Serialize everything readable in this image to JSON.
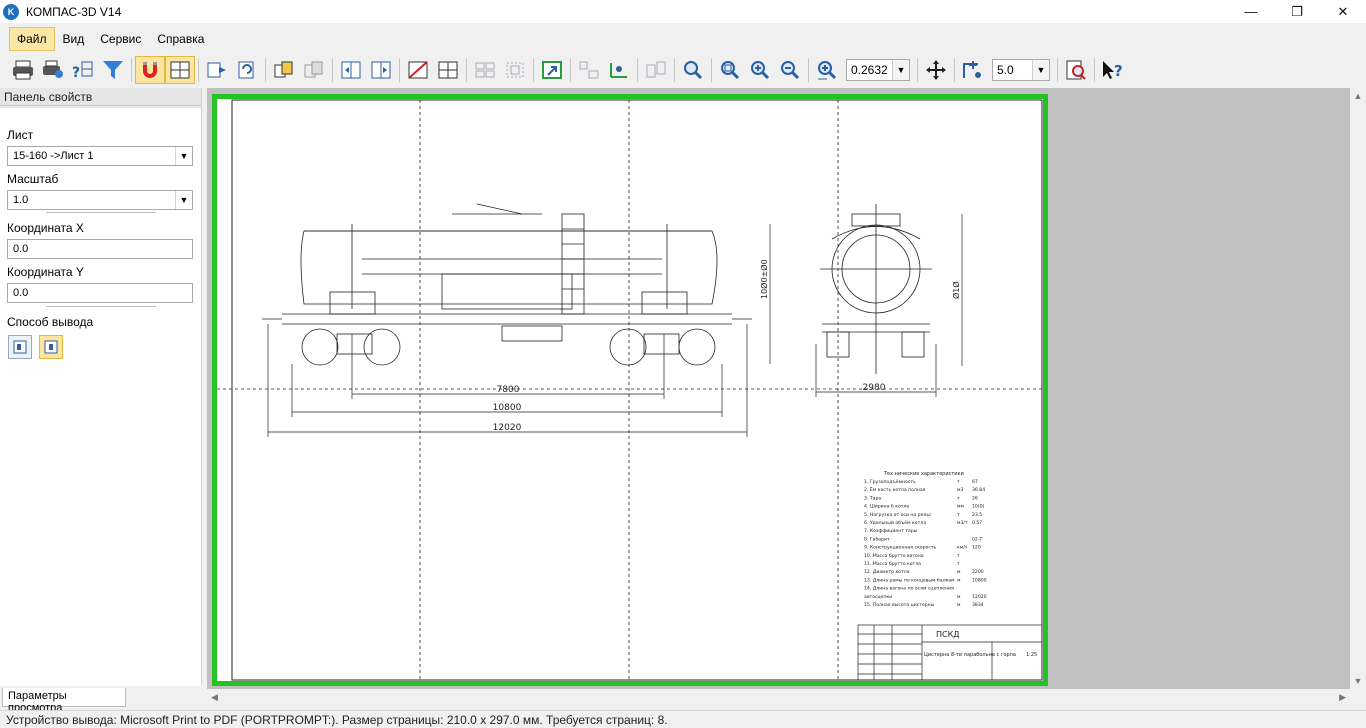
{
  "window": {
    "title": "КОМПАС-3D V14",
    "logo_letter": "K"
  },
  "window_buttons": {
    "minimize": "—",
    "maximize": "❐",
    "close": "✕"
  },
  "menu": [
    {
      "label": "Файл"
    },
    {
      "label": "Вид"
    },
    {
      "label": "Сервис"
    },
    {
      "label": "Справка"
    }
  ],
  "toolbar": {
    "zoom_value": "0.2632",
    "step_value": "5.0"
  },
  "panel": {
    "title": "Панель свойств",
    "sheet_label": "Лист",
    "sheet_value": "15-160 ->Лист 1",
    "scale_label": "Масштаб",
    "scale_value": "1.0",
    "coord_x_label": "Координата X",
    "coord_x_value": "0.0",
    "coord_y_label": "Координата Y",
    "coord_y_value": "0.0",
    "output_label": "Способ вывода",
    "tab_label": "Параметры просмотра"
  },
  "drawing": {
    "dim_7800": "7800",
    "dim_10800": "10800",
    "dim_12020": "12020",
    "dim_2980": "2980",
    "dim_height": "10Ø0±Ø0",
    "dim_height_right": "Ø1Ø",
    "title_block_code": "ПСКД",
    "title_block_name": "Цистерна 8-ти парабольна с горла",
    "title_block_scale": "1:25",
    "spec_title": "Тех нические характеристики",
    "spec_rows": [
      {
        "text": "1.  Грузоподъёмность",
        "unit": "т",
        "val": "67"
      },
      {
        "text": "2.  Ём кость котла полная",
        "unit": "м3",
        "val": "36.84"
      },
      {
        "text": "3.  Тара",
        "unit": "т",
        "val": "26"
      },
      {
        "text": "4.  Ширина б котла",
        "unit": "мм",
        "val": "10(0)"
      },
      {
        "text": "5.  Нагрузка от оси на рельс",
        "unit": "т",
        "val": "23.5"
      },
      {
        "text": "6.  Удельный объём котла",
        "unit": "м3/т",
        "val": "0.57"
      },
      {
        "text": "7.  Коэффициент тары",
        "unit": "",
        "val": ""
      },
      {
        "text": "8.  Габарит",
        "unit": "",
        "val": "02-Т"
      },
      {
        "text": "9.  Конструкционная скорость",
        "unit": "км/ч",
        "val": "120"
      },
      {
        "text": "10. Масса брутто вагона",
        "unit": "т",
        "val": ""
      },
      {
        "text": "11. Масса брутто котла",
        "unit": "т",
        "val": ""
      },
      {
        "text": "12. Диаметр котла",
        "unit": "м",
        "val": "2200"
      },
      {
        "text": "13. Длина рамы по концевым балкам",
        "unit": "м",
        "val": "10800"
      },
      {
        "text": "14. Длина вагона по осям сцепления",
        "unit": "",
        "val": ""
      },
      {
        "text": "    автосцепки",
        "unit": "м",
        "val": "12020"
      },
      {
        "text": "15. Полная высота цистерны",
        "unit": "м",
        "val": "3834"
      }
    ]
  },
  "status": {
    "text": "Устройство вывода: Microsoft Print to PDF (PORTPROMPT:). Размер страницы: 210.0 x 297.0 мм. Требуется страниц: 8."
  },
  "colors": {
    "sheet_border": "#22c322",
    "toolbar_active": "#fbe5a0",
    "workspace": "#c0c0c0"
  }
}
